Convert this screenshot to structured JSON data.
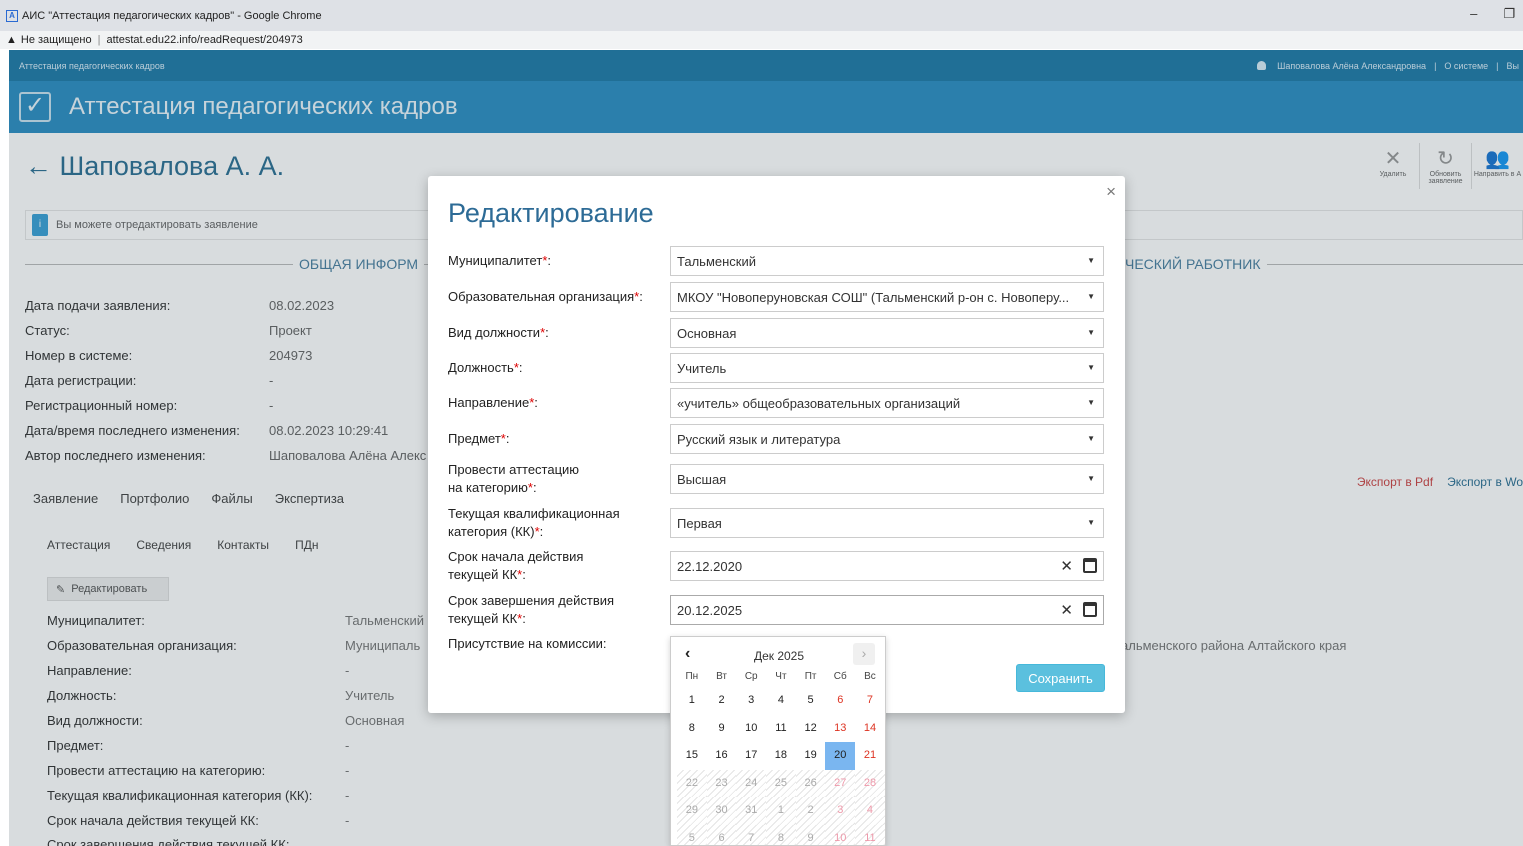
{
  "browser": {
    "window_title": "АИС \"Аттестация педагогических кадров\" - Google Chrome",
    "security_label": "Не защищено",
    "url": "attestat.edu22.info/readRequest/204973"
  },
  "app": {
    "topbar_left": "Аттестация педагогических кадров",
    "user_name": "Шаповалова Алёна Александровна",
    "about": "О системе",
    "exit": "Вы",
    "title": "Аттестация педагогических кадров"
  },
  "page": {
    "person_title": "← Шаповалова А. А.",
    "toolbar": [
      {
        "icon": "close-icon",
        "label": "Удалить"
      },
      {
        "icon": "refresh-icon",
        "label": "Обновить заявление"
      },
      {
        "icon": "users-icon",
        "label": "Направить в А"
      }
    ],
    "notice": "Вы можете отредактировать заявление",
    "section_general": "ОБЩАЯ ИНФОРМ",
    "section_worker": "ЧЕСКИЙ РАБОТНИК",
    "info": [
      {
        "label": "Дата подачи заявления:",
        "value": "08.02.2023"
      },
      {
        "label": "Статус:",
        "value": "Проект"
      },
      {
        "label": "Номер в системе:",
        "value": "204973"
      },
      {
        "label": "Дата регистрации:",
        "value": "-"
      },
      {
        "label": "Регистрационный номер:",
        "value": "-"
      },
      {
        "label": "Дата/время последнего изменения:",
        "value": "08.02.2023 10:29:41"
      },
      {
        "label": "Автор последнего изменения:",
        "value": "Шаповалова Алёна Алекс"
      }
    ],
    "tabs_main": [
      "Заявление",
      "Портфолио",
      "Файлы",
      "Экспертиза"
    ],
    "tabs_sub": [
      "Аттестация",
      "Сведения",
      "Контакты",
      "ПДн"
    ],
    "edit_button": "Редактировать",
    "export_pdf": "Экспорт в Pdf",
    "export_word": "Экспорт в Wo",
    "details": [
      {
        "label": "Муниципалитет:",
        "value": "Тальменский"
      },
      {
        "label": "Образовательная организация:",
        "value": "Муниципаль"
      },
      {
        "label": "Направление:",
        "value": "-"
      },
      {
        "label": "Должность:",
        "value": "Учитель"
      },
      {
        "label": "Вид должности:",
        "value": "Основная"
      },
      {
        "label": "Предмет:",
        "value": "-"
      },
      {
        "label": "Провести аттестацию на категорию:",
        "value": "-"
      },
      {
        "label": "Текущая квалификационная категория (КК):",
        "value": "-"
      },
      {
        "label": "Срок начала действия текущей КК:",
        "value": "-"
      },
      {
        "label": "Срок завершения действия текущей КК:",
        "value": ""
      }
    ],
    "org_tail": "альменского района Алтайского края"
  },
  "modal": {
    "title": "Редактирование",
    "close": "×",
    "fields": {
      "municipality": {
        "label": "Муниципалитет",
        "value": "Тальменский"
      },
      "organization": {
        "label": "Образовательная организация",
        "value": "МКОУ \"Новоперуновская СОШ\" (Тальменский р-он с. Новоперу..."
      },
      "position_type": {
        "label": "Вид должности",
        "value": "Основная"
      },
      "position": {
        "label": "Должность",
        "value": "Учитель"
      },
      "direction": {
        "label": "Направление",
        "value": "«учитель» общеобразовательных организаций"
      },
      "subject": {
        "label": "Предмет",
        "value": "Русский язык и литература"
      },
      "category": {
        "label_line1": "Провести аттестацию",
        "label_line2": "на категорию",
        "value": "Высшая"
      },
      "current_category": {
        "label_line1": "Текущая квалификационная",
        "label_line2": "категория (КК)",
        "value": "Первая"
      },
      "start_date": {
        "label_line1": "Срок начала действия",
        "label_line2": "текущей КК",
        "value": "22.12.2020"
      },
      "end_date": {
        "label_line1": "Срок завершения действия",
        "label_line2": "текущей КК",
        "value": "20.12.2025"
      },
      "presence": {
        "label": "Присутствие на комиссии:"
      }
    },
    "required_mark": "*",
    "colon": ":",
    "save_button": "Сохранить",
    "clear_symbol": "✕"
  },
  "datepicker": {
    "title": "Дек 2025",
    "prev": "‹",
    "next": "›",
    "weekdays": [
      "Пн",
      "Вт",
      "Ср",
      "Чт",
      "Пт",
      "Сб",
      "Вс"
    ],
    "weeks": [
      [
        "1",
        "2",
        "3",
        "4",
        "5",
        "6",
        "7"
      ],
      [
        "8",
        "9",
        "10",
        "11",
        "12",
        "13",
        "14"
      ],
      [
        "15",
        "16",
        "17",
        "18",
        "19",
        "20",
        "21"
      ],
      [
        "22",
        "23",
        "24",
        "25",
        "26",
        "27",
        "28"
      ],
      [
        "29",
        "30",
        "31",
        "1",
        "2",
        "3",
        "4"
      ],
      [
        "5",
        "6",
        "7",
        "8",
        "9",
        "10",
        "11"
      ]
    ],
    "selected": "20",
    "disabled_from_week": 3
  }
}
